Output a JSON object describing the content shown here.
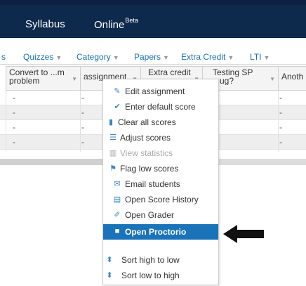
{
  "topnav": {
    "syllabus": "Syllabus",
    "online": "Online",
    "online_badge": "Beta"
  },
  "filters": [
    {
      "label": "s"
    },
    {
      "label": "Quizzes"
    },
    {
      "label": "Category"
    },
    {
      "label": "Papers"
    },
    {
      "label": "Extra Credit"
    },
    {
      "label": "LTI"
    }
  ],
  "columns": [
    {
      "label": "Convert to ...m problem"
    },
    {
      "label": "assignment"
    },
    {
      "label": "Extra credit"
    },
    {
      "label": "Testing SP ...ug?"
    },
    {
      "label": "Anoth"
    }
  ],
  "rows": [
    {
      "c0": "-",
      "c1": "-",
      "c3": "-"
    },
    {
      "c0": "-",
      "c1": "-",
      "c3": "-"
    },
    {
      "c0": "-",
      "c1": "-",
      "c3": "-"
    },
    {
      "c0": "-",
      "c1": "-",
      "c3": "-"
    }
  ],
  "menu": {
    "items": [
      {
        "label": "Edit assignment",
        "icon": "pencil-icon"
      },
      {
        "label": "Enter default score",
        "icon": "checkmark-icon"
      },
      {
        "label": "Clear all scores",
        "icon": "trash-icon"
      },
      {
        "label": "Adjust scores",
        "icon": "sliders-icon"
      },
      {
        "label": "View statistics",
        "icon": "bar-chart-icon",
        "disabled": true
      },
      {
        "label": "Flag low scores",
        "icon": "flag-icon"
      },
      {
        "label": "Email students",
        "icon": "envelope-icon"
      },
      {
        "label": "Open Score History",
        "icon": "book-icon"
      },
      {
        "label": "Open Grader",
        "icon": "edit-square-icon"
      },
      {
        "label": "Open Proctorio",
        "icon": "video-camera-icon",
        "active": true
      },
      {
        "label": "Sort high to low",
        "icon": "sort-icon"
      },
      {
        "label": "Sort low to high",
        "icon": "sort-icon"
      }
    ]
  },
  "colors": {
    "header_bg": "#0d2a4d",
    "link": "#1a6fb0",
    "icon": "#3a86c6",
    "active_bg": "#1a73b8",
    "arrow": "#111111"
  }
}
